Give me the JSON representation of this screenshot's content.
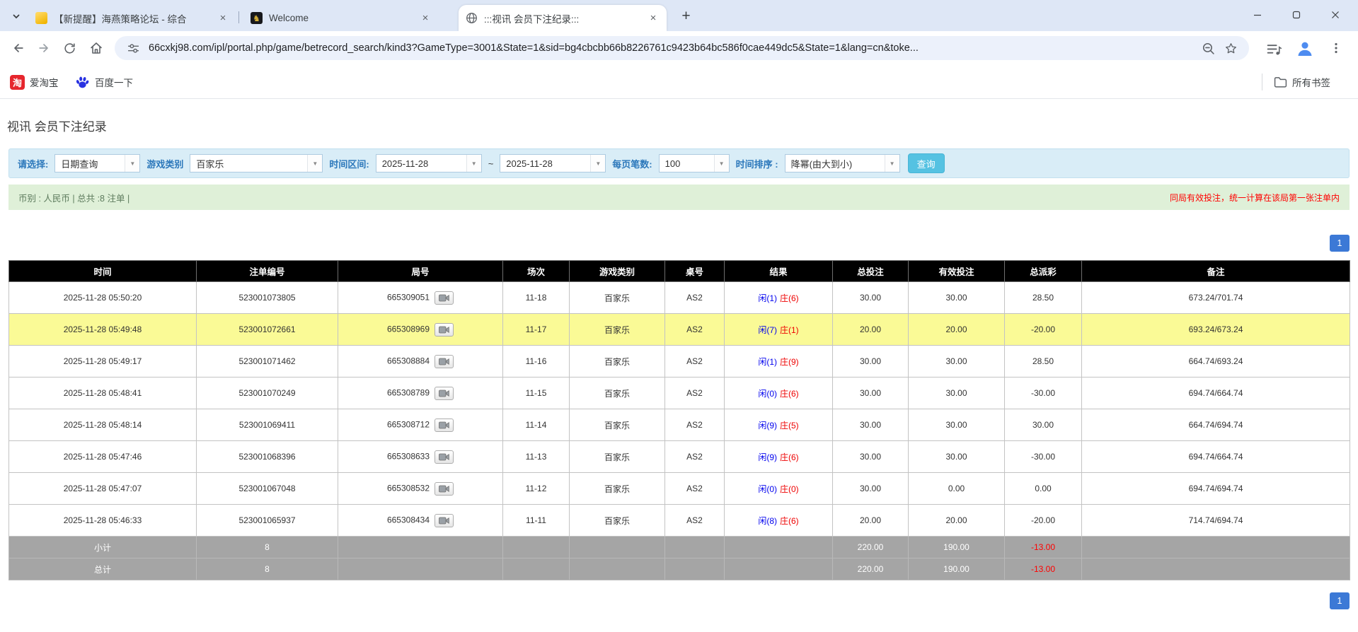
{
  "browser": {
    "tabs": [
      {
        "title": "【新提醒】海燕策略论坛 - 综合",
        "active": false
      },
      {
        "title": "Welcome",
        "active": false
      },
      {
        "title": ":::视讯 会员下注纪录:::",
        "active": true
      }
    ],
    "url": "66cxkj98.com/ipl/portal.php/game/betrecord_search/kind3?GameType=3001&State=1&sid=bg4cbcbb66b8226761c9423b64bc586f0cae449dc5&State=1&lang=cn&toke...",
    "bookmarks": [
      {
        "label": "爱淘宝",
        "badge": "淘"
      },
      {
        "label": "百度一下"
      }
    ],
    "all_bookmarks_label": "所有书签"
  },
  "page": {
    "title": "视讯 会员下注纪录",
    "filters": {
      "select_label": "请选择:",
      "select_value": "日期查询",
      "game_type_label": "游戏类别",
      "game_type_value": "百家乐",
      "date_range_label": "时间区间:",
      "date_from": "2025-11-28",
      "tilde": "~",
      "date_to": "2025-11-28",
      "page_size_label": "每页笔数:",
      "page_size_value": "100",
      "sort_label": "时间排序 :",
      "sort_value": "降幂(由大到小)",
      "query_button": "查询"
    },
    "summary": {
      "left": "币别 : 人民币 | 总共 :8 注单 |",
      "right_notice": "同局有效投注，统一计算在该局第一张注单内"
    },
    "pagination": {
      "page": "1"
    },
    "table": {
      "headers": [
        "时间",
        "注单编号",
        "局号",
        "场次",
        "游戏类别",
        "桌号",
        "结果",
        "总投注",
        "有效投注",
        "总派彩",
        "备注"
      ],
      "rows": [
        {
          "time": "2025-11-28 05:50:20",
          "bet_id": "523001073805",
          "round_id": "665309051",
          "session": "11-18",
          "game": "百家乐",
          "table_no": "AS2",
          "result_player": "闲(1)",
          "result_banker": "庄(6)",
          "total_bet": "30.00",
          "valid_bet": "30.00",
          "payout": "28.50",
          "note": "673.24/701.74",
          "highlight": false
        },
        {
          "time": "2025-11-28 05:49:48",
          "bet_id": "523001072661",
          "round_id": "665308969",
          "session": "11-17",
          "game": "百家乐",
          "table_no": "AS2",
          "result_player": "闲(7)",
          "result_banker": "庄(1)",
          "total_bet": "20.00",
          "valid_bet": "20.00",
          "payout": "-20.00",
          "note": "693.24/673.24",
          "highlight": true
        },
        {
          "time": "2025-11-28 05:49:17",
          "bet_id": "523001071462",
          "round_id": "665308884",
          "session": "11-16",
          "game": "百家乐",
          "table_no": "AS2",
          "result_player": "闲(1)",
          "result_banker": "庄(9)",
          "total_bet": "30.00",
          "valid_bet": "30.00",
          "payout": "28.50",
          "note": "664.74/693.24",
          "highlight": false
        },
        {
          "time": "2025-11-28 05:48:41",
          "bet_id": "523001070249",
          "round_id": "665308789",
          "session": "11-15",
          "game": "百家乐",
          "table_no": "AS2",
          "result_player": "闲(0)",
          "result_banker": "庄(6)",
          "total_bet": "30.00",
          "valid_bet": "30.00",
          "payout": "-30.00",
          "note": "694.74/664.74",
          "highlight": false
        },
        {
          "time": "2025-11-28 05:48:14",
          "bet_id": "523001069411",
          "round_id": "665308712",
          "session": "11-14",
          "game": "百家乐",
          "table_no": "AS2",
          "result_player": "闲(9)",
          "result_banker": "庄(5)",
          "total_bet": "30.00",
          "valid_bet": "30.00",
          "payout": "30.00",
          "note": "664.74/694.74",
          "highlight": false
        },
        {
          "time": "2025-11-28 05:47:46",
          "bet_id": "523001068396",
          "round_id": "665308633",
          "session": "11-13",
          "game": "百家乐",
          "table_no": "AS2",
          "result_player": "闲(9)",
          "result_banker": "庄(6)",
          "total_bet": "30.00",
          "valid_bet": "30.00",
          "payout": "-30.00",
          "note": "694.74/664.74",
          "highlight": false
        },
        {
          "time": "2025-11-28 05:47:07",
          "bet_id": "523001067048",
          "round_id": "665308532",
          "session": "11-12",
          "game": "百家乐",
          "table_no": "AS2",
          "result_player": "闲(0)",
          "result_banker": "庄(0)",
          "total_bet": "30.00",
          "valid_bet": "0.00",
          "payout": "0.00",
          "note": "694.74/694.74",
          "highlight": false
        },
        {
          "time": "2025-11-28 05:46:33",
          "bet_id": "523001065937",
          "round_id": "665308434",
          "session": "11-11",
          "game": "百家乐",
          "table_no": "AS2",
          "result_player": "闲(8)",
          "result_banker": "庄(6)",
          "total_bet": "20.00",
          "valid_bet": "20.00",
          "payout": "-20.00",
          "note": "714.74/694.74",
          "highlight": false
        }
      ],
      "subtotal": {
        "label": "小计",
        "count": "8",
        "total_bet": "220.00",
        "valid_bet": "190.00",
        "payout": "-13.00"
      },
      "total": {
        "label": "总计",
        "count": "8",
        "total_bet": "220.00",
        "valid_bet": "190.00",
        "payout": "-13.00"
      }
    }
  },
  "colors": {
    "pager_blue": "#3c79d6",
    "highlight_yellow": "#fafa96",
    "link_blue": "#0066cc",
    "negative_red": "#ff0000",
    "player_blue": "#0000ee",
    "banker_red": "#ee0000",
    "filter_bg": "#d9edf7",
    "summary_bg": "#dff0d8",
    "query_button_bg": "#55c2e2",
    "header_bg": "#000000",
    "footer_gray": "#a5a5a5"
  }
}
